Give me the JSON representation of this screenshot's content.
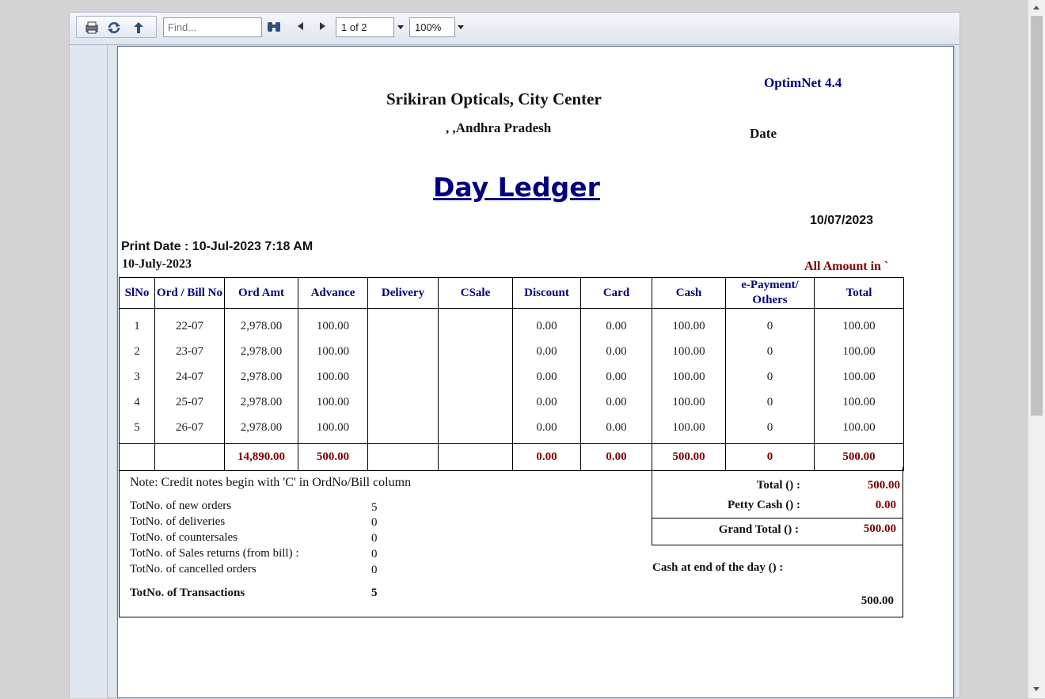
{
  "toolbar": {
    "find_placeholder": "Find...",
    "page_indicator": "1 of 2",
    "zoom": "100%",
    "icons": [
      "print-icon",
      "refresh-icon",
      "export-icon",
      "binoculars-icon",
      "prev-page-icon",
      "next-page-icon"
    ]
  },
  "report": {
    "brand": "OptimNet 4.4",
    "company": "Srikiran Opticals, City Center",
    "address": ", ,Andhra Pradesh",
    "date_label": "Date",
    "title": "Day Ledger",
    "date_value": "10/07/2023",
    "print_date": "Print Date : 10-Jul-2023  7:18 AM",
    "report_date": "10-July-2023",
    "amount_note": "All Amount in `",
    "columns": [
      "SlNo",
      "Ord / Bill No",
      "Ord Amt",
      "Advance",
      "Delivery",
      "CSale",
      "Discount",
      "Card",
      "Cash",
      "e-Payment/ Others",
      "Total"
    ],
    "rows": [
      {
        "slno": "1",
        "bill": "22-07",
        "ord_amt": "2,978.00",
        "advance": "100.00",
        "delivery": "",
        "csale": "",
        "discount": "0.00",
        "card": "0.00",
        "cash": "100.00",
        "epay": "0",
        "total": "100.00"
      },
      {
        "slno": "2",
        "bill": "23-07",
        "ord_amt": "2,978.00",
        "advance": "100.00",
        "delivery": "",
        "csale": "",
        "discount": "0.00",
        "card": "0.00",
        "cash": "100.00",
        "epay": "0",
        "total": "100.00"
      },
      {
        "slno": "3",
        "bill": "24-07",
        "ord_amt": "2,978.00",
        "advance": "100.00",
        "delivery": "",
        "csale": "",
        "discount": "0.00",
        "card": "0.00",
        "cash": "100.00",
        "epay": "0",
        "total": "100.00"
      },
      {
        "slno": "4",
        "bill": "25-07",
        "ord_amt": "2,978.00",
        "advance": "100.00",
        "delivery": "",
        "csale": "",
        "discount": "0.00",
        "card": "0.00",
        "cash": "100.00",
        "epay": "0",
        "total": "100.00"
      },
      {
        "slno": "5",
        "bill": "26-07",
        "ord_amt": "2,978.00",
        "advance": "100.00",
        "delivery": "",
        "csale": "",
        "discount": "0.00",
        "card": "0.00",
        "cash": "100.00",
        "epay": "0",
        "total": "100.00"
      }
    ],
    "totals": {
      "ord_amt": "14,890.00",
      "advance": "500.00",
      "discount": "0.00",
      "card": "0.00",
      "cash": "500.00",
      "epay": "0",
      "total": "500.00"
    },
    "note": "Note: Credit notes begin with 'C' in OrdNo/Bill column",
    "counts": [
      {
        "label": "TotNo. of new orders",
        "value": "5"
      },
      {
        "label": "TotNo. of deliveries",
        "value": "0"
      },
      {
        "label": "TotNo. of countersales",
        "value": "0"
      },
      {
        "label": "TotNo. of Sales returns (from bill) :",
        "value": "0"
      },
      {
        "label": "TotNo. of cancelled orders",
        "value": "0"
      }
    ],
    "transactions": {
      "label": "TotNo. of Transactions",
      "value": "5"
    },
    "summary": {
      "total_label": "Total () :",
      "total_value": "500.00",
      "petty_label": "Petty Cash () :",
      "petty_value": "0.00",
      "grand_label": "Grand Total () :",
      "grand_value": "500.00",
      "cash_end_label": "Cash at end of the day () :",
      "cash_end_value": "500.00"
    }
  }
}
